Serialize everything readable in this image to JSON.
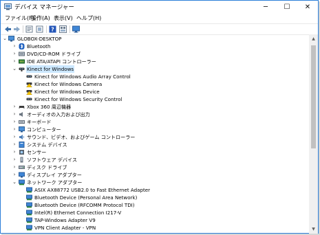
{
  "window": {
    "title": "デバイス マネージャー",
    "controls": {
      "minimize": "─",
      "maximize": "☐",
      "close": "✕"
    }
  },
  "menu": [
    "ファイル(F)",
    "操作(A)",
    "表示(V)",
    "ヘルプ(H)"
  ],
  "toolbar": [
    "back-icon",
    "forward-icon",
    "properties-icon",
    "update-driver-icon",
    "help-icon",
    "view-icon",
    "monitor-icon"
  ],
  "tree": {
    "root": "GLOBOX-DESKTOP",
    "items": [
      {
        "label": "Bluetooth",
        "state": "collapsed"
      },
      {
        "label": "DVD/CD-ROM ドライブ",
        "state": "collapsed"
      },
      {
        "label": "IDE ATA/ATAPI コントローラー",
        "state": "collapsed"
      },
      {
        "label": "Kinect for Windows",
        "state": "expanded",
        "selected": true
      },
      {
        "label": "Kinect for Windows Audio Array Control",
        "level": 2
      },
      {
        "label": "Kinect for Windows Camera",
        "level": 2,
        "warning": true
      },
      {
        "label": "Kinect for Windows Device",
        "level": 2,
        "warning": true
      },
      {
        "label": "Kinect for Windows Security Control",
        "level": 2
      },
      {
        "label": "Xbox 360 周辺機器",
        "state": "collapsed"
      },
      {
        "label": "オーディオの入力および出力",
        "state": "collapsed"
      },
      {
        "label": "キーボード",
        "state": "collapsed"
      },
      {
        "label": "コンピューター",
        "state": "collapsed"
      },
      {
        "label": "サウンド、ビデオ、およびゲーム コントローラー",
        "state": "collapsed"
      },
      {
        "label": "システム デバイス",
        "state": "collapsed"
      },
      {
        "label": "センサー",
        "state": "collapsed"
      },
      {
        "label": "ソフトウェア デバイス",
        "state": "collapsed"
      },
      {
        "label": "ディスク ドライブ",
        "state": "collapsed"
      },
      {
        "label": "ディスプレイ アダプター",
        "state": "collapsed"
      },
      {
        "label": "ネットワーク アダプター",
        "state": "expanded"
      },
      {
        "label": "ASIX AX88772 USB2.0 to Fast Ethernet Adapter",
        "level": 2
      },
      {
        "label": "Bluetooth Device (Personal Area Network)",
        "level": 2
      },
      {
        "label": "Bluetooth Device (RFCOMM Protocol TDI)",
        "level": 2
      },
      {
        "label": "Intel(R) Ethernet Connection I217-V",
        "level": 2
      },
      {
        "label": "TAP-Windows Adapter V9",
        "level": 2
      },
      {
        "label": "VPN Client Adapter - VPN",
        "level": 2
      }
    ]
  },
  "colors": {
    "accent": "#2b7ed8",
    "selection": "#cce8ff",
    "warning": "#f5c400"
  }
}
